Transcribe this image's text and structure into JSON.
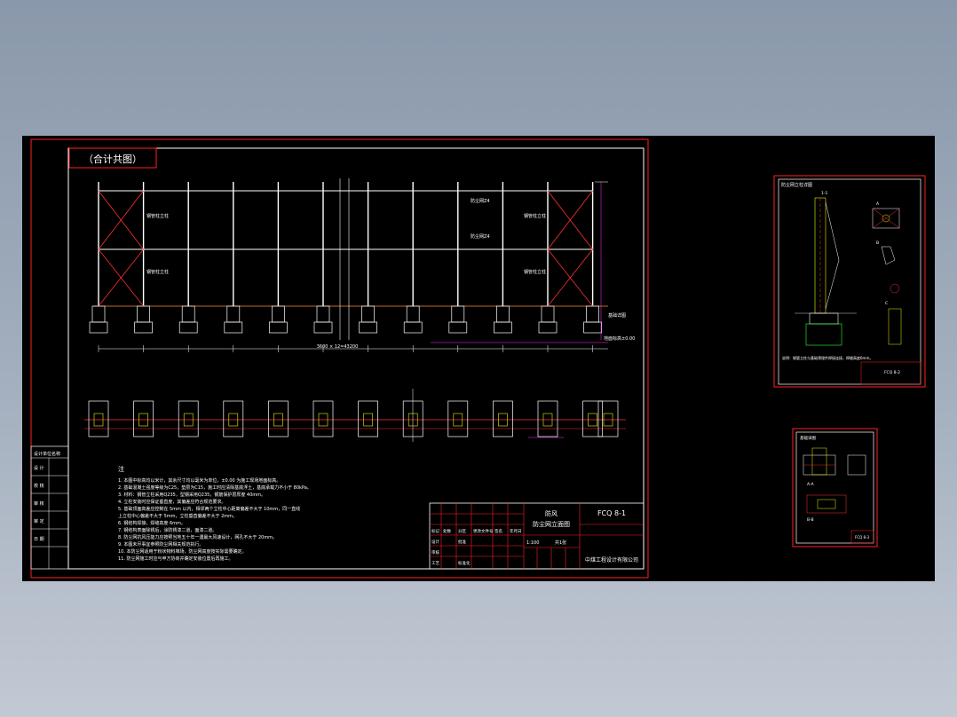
{
  "main_sheet": {
    "heading_label": "（合计共图）",
    "dimension_total": "3600 × 12=43200",
    "pole_labels": [
      "钢管柱立柱",
      "钢管柱立柱",
      "钢管柱立柱",
      "钢管柱立柱"
    ],
    "net_labels": [
      "防尘网Z4",
      "防尘网Z4"
    ],
    "foundation_label": "基础详图",
    "ground_label": "地面标高±0.00",
    "notes_title": "注",
    "notes": [
      "1. 本图中标高均以米计，其余尺寸均以毫米为单位，±0.00 为施工现场地面标高。",
      "2. 基础混凝土强度等级为C25，垫层为C15，施工时应清除基底浮土，基底承载力不小于 80kPa。",
      "3. 材料：钢管立柱采用Q235，型钢采用Q235，钢筋保护层厚度 40mm。",
      "4. 立柱安装时应保证垂直度，其偏差应符合规范要求。",
      "5. 基础顶面高差应控制在 5mm 以内，相邻两个立柱中心距离偏差不大于 10mm，同一直线",
      "   上立柱中心偏差不大于 5mm，立柱垂直偏差不大于 2mm。",
      "6. 钢结构焊接，焊缝高度 6mm。",
      "7. 钢结构表面除锈后，涂防锈漆二道，面漆二道。",
      "8. 防尘网抗风压能力应按照当地五十年一遇最大风速设计，网孔不大于 20mm。",
      "9. 本图未尽事宜参照防尘网相关规范执行。",
      "10. 本防尘网适用于粉状物料堆场，防尘网高度按实际需要确定。",
      "11. 防尘网施工时应与甲方协商并确定安装位置后再施工。"
    ],
    "left_column": [
      "设计单位名称",
      "设 计",
      "校 核",
      "审 核",
      "审 定",
      "日 期"
    ],
    "title_block": {
      "drawing_name_line1": "防风",
      "drawing_name_line2": "防尘网立面图",
      "drawing_no": "FCQ 8-1",
      "scale": "1:100",
      "sheet": "共1张",
      "company": "中煤工程设计有限公司",
      "header_cells": [
        "标记",
        "处数",
        "分区",
        "更改文件号",
        "签名",
        "年月日"
      ],
      "role_cells": [
        "设计",
        "审核",
        "工艺",
        "批准",
        "标准化"
      ]
    }
  },
  "detail_sheet_1": {
    "heading": "防尘网立柱详图",
    "label_a": "1-1",
    "label_b": "A",
    "label_c": "B",
    "label_d": "C",
    "note": "说明：钢管立柱与基础预埋件焊接连接，焊缝高度6mm。",
    "drawing_no": "FCQ 8-2"
  },
  "detail_sheet_2": {
    "heading": "基础详图",
    "label_a": "A-A",
    "label_b": "B-B",
    "drawing_no": "FCQ 8-3"
  }
}
